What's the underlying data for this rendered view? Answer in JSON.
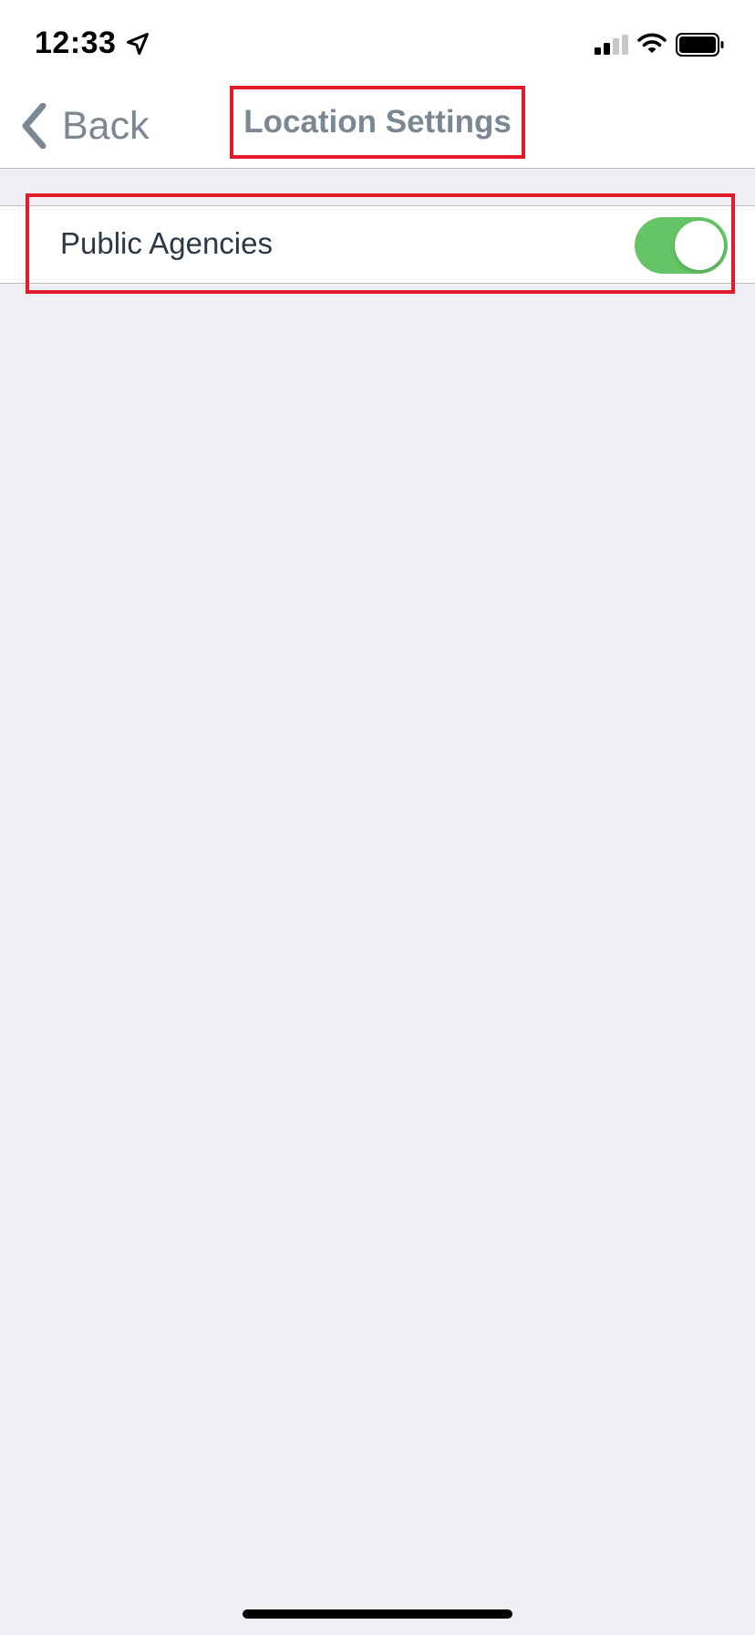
{
  "status_bar": {
    "time": "12:33",
    "icons": [
      "location-arrow-icon",
      "cellular-signal-icon",
      "wifi-icon",
      "battery-icon"
    ]
  },
  "nav_bar": {
    "back_label": "Back",
    "title": "Location Settings"
  },
  "settings": {
    "rows": [
      {
        "label": "Public Agencies",
        "toggle_on": true
      }
    ]
  },
  "colors": {
    "accent_gray": "#7b8894",
    "toggle_on": "#64c466",
    "highlight_red": "#e21b2c",
    "background": "#efeff4"
  }
}
